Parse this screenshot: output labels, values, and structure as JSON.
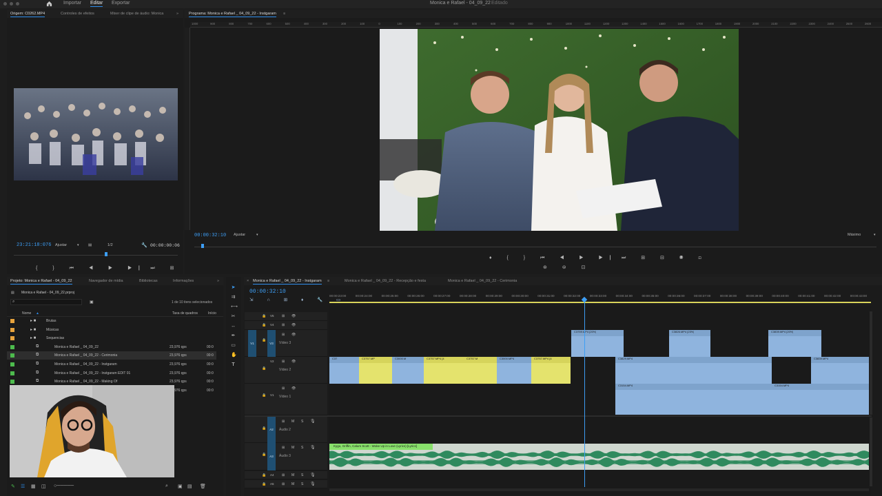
{
  "app": {
    "title": "Monica e Rafael - 04_09_22",
    "status": "Editado",
    "tabs": [
      "Importar",
      "Editar",
      "Exportar"
    ],
    "active_tab": "Editar",
    "colors": {
      "accent": "#2d8ceb",
      "clip_blue": "#8fb4de",
      "clip_yellow": "#e4e36d",
      "audio_wave": "#2f8a5e",
      "timecode": "#3d9ef5"
    }
  },
  "source_monitor": {
    "tabs": [
      "Origem: C0262.MP4",
      "Controles de efeitos",
      "Mixer de clipe de áudio: Monica"
    ],
    "timecode": "23:21:18:076",
    "fit": "Ajustar",
    "resolution": "1/2",
    "duration": "00:00:00:06",
    "thumbnail": "dancing-crowd"
  },
  "program_monitor": {
    "title": "Programa: Monica e Rafael _ 04_09_22 - Instgaram",
    "timecode": "00:00:32:10",
    "fit": "Ajustar",
    "quality": "Máximo",
    "frame": "wedding-ceremony",
    "ruler_labels": [
      "1000",
      "900",
      "800",
      "700",
      "600",
      "500",
      "400",
      "300",
      "200",
      "100",
      "0",
      "100",
      "200",
      "300",
      "400",
      "500",
      "600",
      "700",
      "800",
      "900",
      "1000",
      "1100",
      "1200",
      "1300",
      "1400",
      "1500",
      "1600",
      "1700",
      "1800",
      "1900",
      "2000",
      "2100",
      "2200",
      "2300",
      "2400",
      "2500",
      "2600"
    ]
  },
  "project": {
    "tabs": [
      "Projeto: Monica e Rafael - 04_09_22",
      "Navegador de mídia",
      "Bibliotecas",
      "Informações"
    ],
    "file": "Monica e Rafael - 04_09_22.prproj",
    "selection": "1 de 10 itens selecionados",
    "columns": {
      "name": "Nome",
      "fps": "Taxa de quadros",
      "start": "Início"
    },
    "rows": [
      {
        "name": "Brutas",
        "type": "folder",
        "color": "#e8a33d",
        "fps": "",
        "start": ""
      },
      {
        "name": "Músicas",
        "type": "folder",
        "color": "#e8a33d",
        "fps": "",
        "start": ""
      },
      {
        "name": "Sequencias",
        "type": "folder",
        "color": "#e8a33d",
        "fps": "",
        "start": ""
      },
      {
        "name": "Monica e Rafael _ 04_09_22",
        "type": "sequence",
        "color": "#4dbb4d",
        "fps": "23,976 qps",
        "start": "00:0"
      },
      {
        "name": "Monica e Rafael _ 04_09_22 - Cerimonia",
        "type": "sequence",
        "color": "#4dbb4d",
        "fps": "23,976 qps",
        "start": "00:0"
      },
      {
        "name": "Monica e Rafael _ 04_09_22 - Instgaram",
        "type": "sequence",
        "color": "#4dbb4d",
        "fps": "23,976 qps",
        "start": "00:0"
      },
      {
        "name": "Monica e Rafael _ 04_09_22 - Instgaram EDIT 01",
        "type": "sequence",
        "color": "#4dbb4d",
        "fps": "23,976 qps",
        "start": "00:0"
      },
      {
        "name": "Monica e Rafael _ 04_09_22 - Making Of",
        "type": "sequence",
        "color": "#4dbb4d",
        "fps": "23,976 qps",
        "start": "00:0"
      },
      {
        "name": "",
        "type": "sequence",
        "color": "",
        "fps": "23,976 qps",
        "start": "00:0"
      }
    ]
  },
  "timeline": {
    "tabs": [
      "Monica e Rafael _ 04_09_22 - Instgaram",
      "Monica e Rafael _ 04_09_22 - Recepção e festa",
      "Monica e Rafael _ 04_09_22 - Cerimonia"
    ],
    "timecode": "00:00:32:10",
    "ticks": [
      "00:00:23:00",
      "00:00:24:00",
      "00:00:25:00",
      "00:00:26:00",
      "00:00:27:00",
      "00:00:28:00",
      "00:00:29:00",
      "00:00:30:00",
      "00:00:31:00",
      "00:00:32:00",
      "00:00:33:00",
      "00:00:34:00",
      "00:00:35:00",
      "00:00:36:00",
      "00:00:37:00",
      "00:00:38:00",
      "00:00:39:00",
      "00:00:40:00",
      "00:00:41:00",
      "00:00:42:00",
      "00:00:43:00"
    ],
    "tracks": {
      "v5": "V5",
      "v4": "V4",
      "v3": "V3",
      "v2": "V2",
      "v1": "V1",
      "v1_target": "V1",
      "video3": "Vídeo 3",
      "video2": "Vídeo 2",
      "video1": "Vídeo 1",
      "a2": "A2",
      "a3": "A3",
      "a4": "A4",
      "a5": "A5",
      "audio2": "Áudio 2",
      "audio3": "Áudio 3"
    },
    "clips": {
      "v3": [
        "C3759.MP4 [20%]",
        "C3826.MP4 [23%]",
        "C3839.MP4 [20%]"
      ],
      "v2": [
        "C37",
        "C3757.MP",
        "C3000.M",
        "C3757.MP4 [4",
        "C3757.M",
        "C3000.MP4",
        "C3757.MP4 [4",
        "C3829.MP4",
        "C3839.MP4"
      ],
      "v1": [
        "C3154.MP4",
        "C3154.MP4"
      ],
      "a3": "Kygo, Griffin, Calum Scott - Woke Up in Love (Lyrics) [Lyrics]"
    }
  },
  "webcam": {
    "subject": "editor-with-headphones"
  }
}
